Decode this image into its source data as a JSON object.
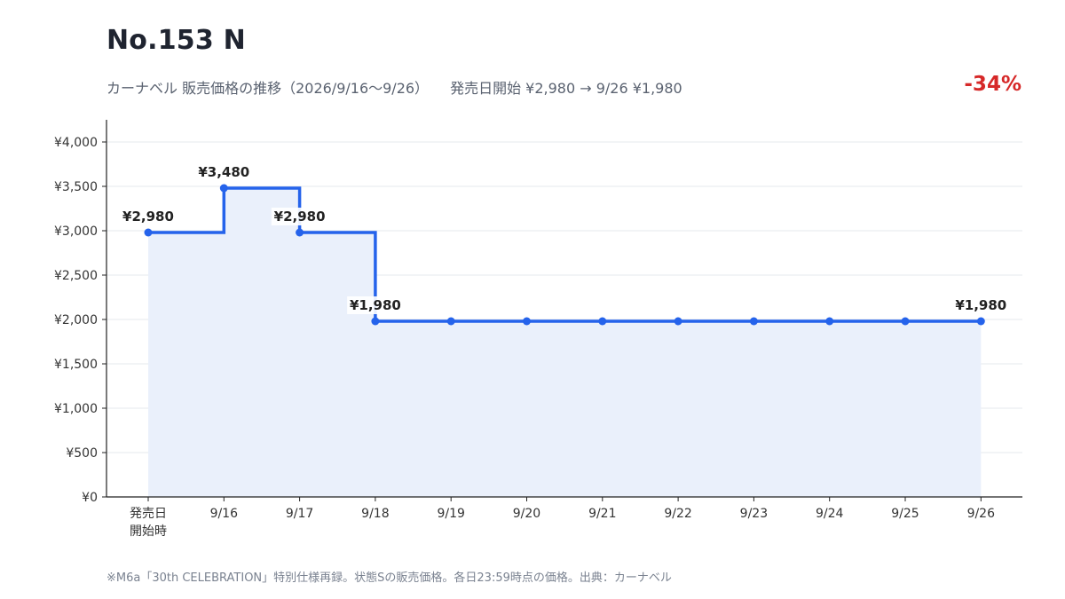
{
  "header": {
    "title": "No.153 N",
    "subtitle_main": "カーナベル 販売価格の推移（2026/9/16〜9/26）",
    "subtitle_detail": "発売日開始 ¥2,980 → 9/26 ¥1,980",
    "change_pct": "-34%"
  },
  "footnote": "※M6a「30th CELEBRATION」特別仕様再録。状態Sの販売価格。各日23:59時点の価格。出典：カーナベル",
  "colors": {
    "line": "#2563eb",
    "area": "#eaf0fb",
    "change_negative": "#d62828",
    "grid": "#e6e8ec",
    "axis": "#222222"
  },
  "chart_data": {
    "type": "line",
    "step": "after",
    "categories": [
      "発売日\n開始時",
      "9/16",
      "9/17",
      "9/18",
      "9/19",
      "9/20",
      "9/21",
      "9/22",
      "9/23",
      "9/24",
      "9/25",
      "9/26"
    ],
    "values": [
      2980,
      3480,
      2980,
      1980,
      1980,
      1980,
      1980,
      1980,
      1980,
      1980,
      1980,
      1980
    ],
    "point_labels": [
      "¥2,980",
      "¥3,480",
      "¥2,980",
      "¥1,980",
      "",
      "",
      "",
      "",
      "",
      "",
      "",
      "¥1,980"
    ],
    "yticks": [
      0,
      500,
      1000,
      1500,
      2000,
      2500,
      3000,
      3500,
      4000
    ],
    "ytick_labels": [
      "¥0",
      "¥500",
      "¥1,000",
      "¥1,500",
      "¥2,000",
      "¥2,500",
      "¥3,000",
      "¥3,500",
      "¥4,000"
    ],
    "ylim": [
      0,
      4250
    ],
    "grid": true,
    "area_fill": true
  }
}
